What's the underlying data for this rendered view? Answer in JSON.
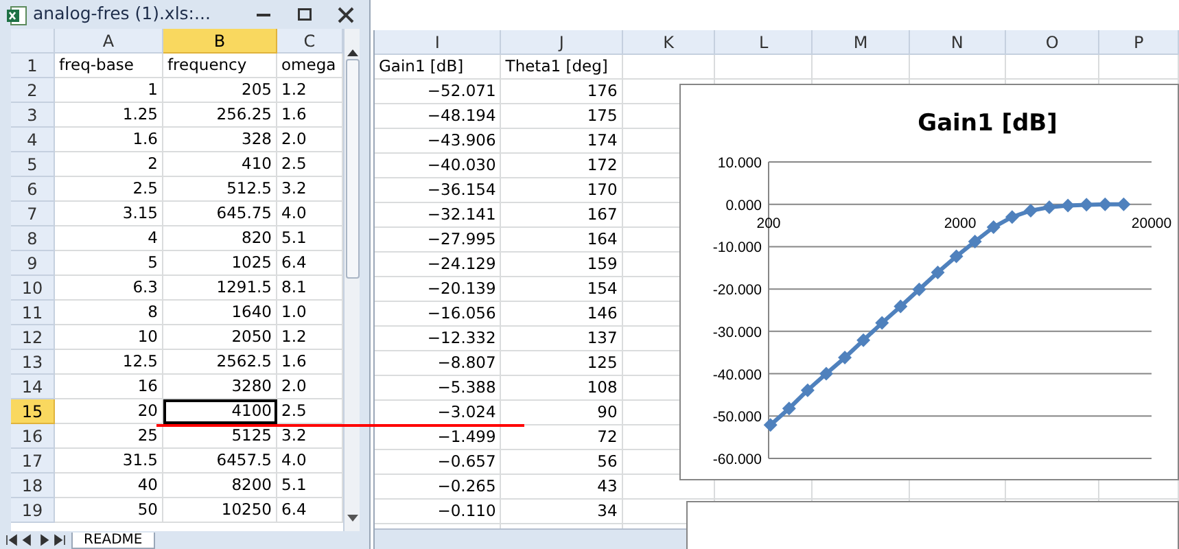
{
  "left_window": {
    "title": "analog-fres (1).xls:...",
    "columns": [
      {
        "label": "A",
        "selected": false
      },
      {
        "label": "B",
        "selected": true
      },
      {
        "label": "C",
        "selected": false
      }
    ],
    "rows": [
      {
        "number": "1",
        "selected": false,
        "cells": [
          "freq-base",
          "frequency",
          "omega"
        ]
      },
      {
        "number": "2",
        "selected": false,
        "cells": [
          "1",
          "205",
          "1.2"
        ]
      },
      {
        "number": "3",
        "selected": false,
        "cells": [
          "1.25",
          "256.25",
          "1.6"
        ]
      },
      {
        "number": "4",
        "selected": false,
        "cells": [
          "1.6",
          "328",
          "2.0"
        ]
      },
      {
        "number": "5",
        "selected": false,
        "cells": [
          "2",
          "410",
          "2.5"
        ]
      },
      {
        "number": "6",
        "selected": false,
        "cells": [
          "2.5",
          "512.5",
          "3.2"
        ]
      },
      {
        "number": "7",
        "selected": false,
        "cells": [
          "3.15",
          "645.75",
          "4.0"
        ]
      },
      {
        "number": "8",
        "selected": false,
        "cells": [
          "4",
          "820",
          "5.1"
        ]
      },
      {
        "number": "9",
        "selected": false,
        "cells": [
          "5",
          "1025",
          "6.4"
        ]
      },
      {
        "number": "10",
        "selected": false,
        "cells": [
          "6.3",
          "1291.5",
          "8.1"
        ]
      },
      {
        "number": "11",
        "selected": false,
        "cells": [
          "8",
          "1640",
          "1.0"
        ]
      },
      {
        "number": "12",
        "selected": false,
        "cells": [
          "10",
          "2050",
          "1.2"
        ]
      },
      {
        "number": "13",
        "selected": false,
        "cells": [
          "12.5",
          "2562.5",
          "1.6"
        ]
      },
      {
        "number": "14",
        "selected": false,
        "cells": [
          "16",
          "3280",
          "2.0"
        ]
      },
      {
        "number": "15",
        "selected": true,
        "cells": [
          "20",
          "4100",
          "2.5"
        ]
      },
      {
        "number": "16",
        "selected": false,
        "cells": [
          "25",
          "5125",
          "3.2"
        ]
      },
      {
        "number": "17",
        "selected": false,
        "cells": [
          "31.5",
          "6457.5",
          "4.0"
        ]
      },
      {
        "number": "18",
        "selected": false,
        "cells": [
          "40",
          "8200",
          "5.1"
        ]
      },
      {
        "number": "19",
        "selected": false,
        "cells": [
          "50",
          "10250",
          "6.4"
        ]
      }
    ],
    "sheet_tabs": [
      {
        "label": "README"
      }
    ]
  },
  "right_sheet": {
    "columns": [
      "I",
      "J",
      "K",
      "L",
      "M",
      "N",
      "O",
      "P"
    ],
    "rows": [
      {
        "cells": [
          "Gain1 [dB]",
          "Theta1 [deg]"
        ]
      },
      {
        "cells": [
          "−52.071",
          "176"
        ]
      },
      {
        "cells": [
          "−48.194",
          "175"
        ]
      },
      {
        "cells": [
          "−43.906",
          "174"
        ]
      },
      {
        "cells": [
          "−40.030",
          "172"
        ]
      },
      {
        "cells": [
          "−36.154",
          "170"
        ]
      },
      {
        "cells": [
          "−32.141",
          "167"
        ]
      },
      {
        "cells": [
          "−27.995",
          "164"
        ]
      },
      {
        "cells": [
          "−24.129",
          "159"
        ]
      },
      {
        "cells": [
          "−20.139",
          "154"
        ]
      },
      {
        "cells": [
          "−16.056",
          "146"
        ]
      },
      {
        "cells": [
          "−12.332",
          "137"
        ]
      },
      {
        "cells": [
          "−8.807",
          "125"
        ]
      },
      {
        "cells": [
          "−5.388",
          "108"
        ]
      },
      {
        "cells": [
          "−3.024",
          "90"
        ]
      },
      {
        "cells": [
          "−1.499",
          "72"
        ]
      },
      {
        "cells": [
          "−0.657",
          "56"
        ]
      },
      {
        "cells": [
          "−0.265",
          "43"
        ]
      },
      {
        "cells": [
          "−0.110",
          "34"
        ]
      }
    ]
  },
  "chart": {
    "chart_data": {
      "type": "line",
      "title": "Gain1 [dB]",
      "categories": [
        null,
        null,
        null,
        null,
        null,
        null,
        null,
        null,
        null,
        null,
        null,
        null,
        null,
        null,
        null,
        null,
        null,
        null,
        null,
        null
      ],
      "grid": true,
      "series": [
        {
          "color": "#4f81bd",
          "marker": "diamond",
          "values": [
            -52.1,
            -48.2,
            -43.9,
            -40.0,
            -36.2,
            -32.1,
            -28.0,
            -24.1,
            -20.1,
            -16.1,
            -12.3,
            -8.8,
            -5.4,
            -3.0,
            -1.5,
            -0.7,
            -0.3,
            -0.1,
            0.0,
            0.0
          ]
        }
      ],
      "ylim": [
        -60,
        10
      ],
      "yticks": [
        {
          "value": 10,
          "label": "10.000"
        },
        {
          "value": 0,
          "label": "0.000"
        },
        {
          "value": -10,
          "label": "-10.000"
        },
        {
          "value": -20,
          "label": "-20.000"
        },
        {
          "value": -30,
          "label": "-30.000"
        },
        {
          "value": -40,
          "label": "-40.000"
        },
        {
          "value": -50,
          "label": "-50.000"
        },
        {
          "value": -60,
          "label": "-60.000"
        }
      ]
    },
    "x_axis_labels": [
      "200",
      "2000",
      "20000"
    ]
  }
}
